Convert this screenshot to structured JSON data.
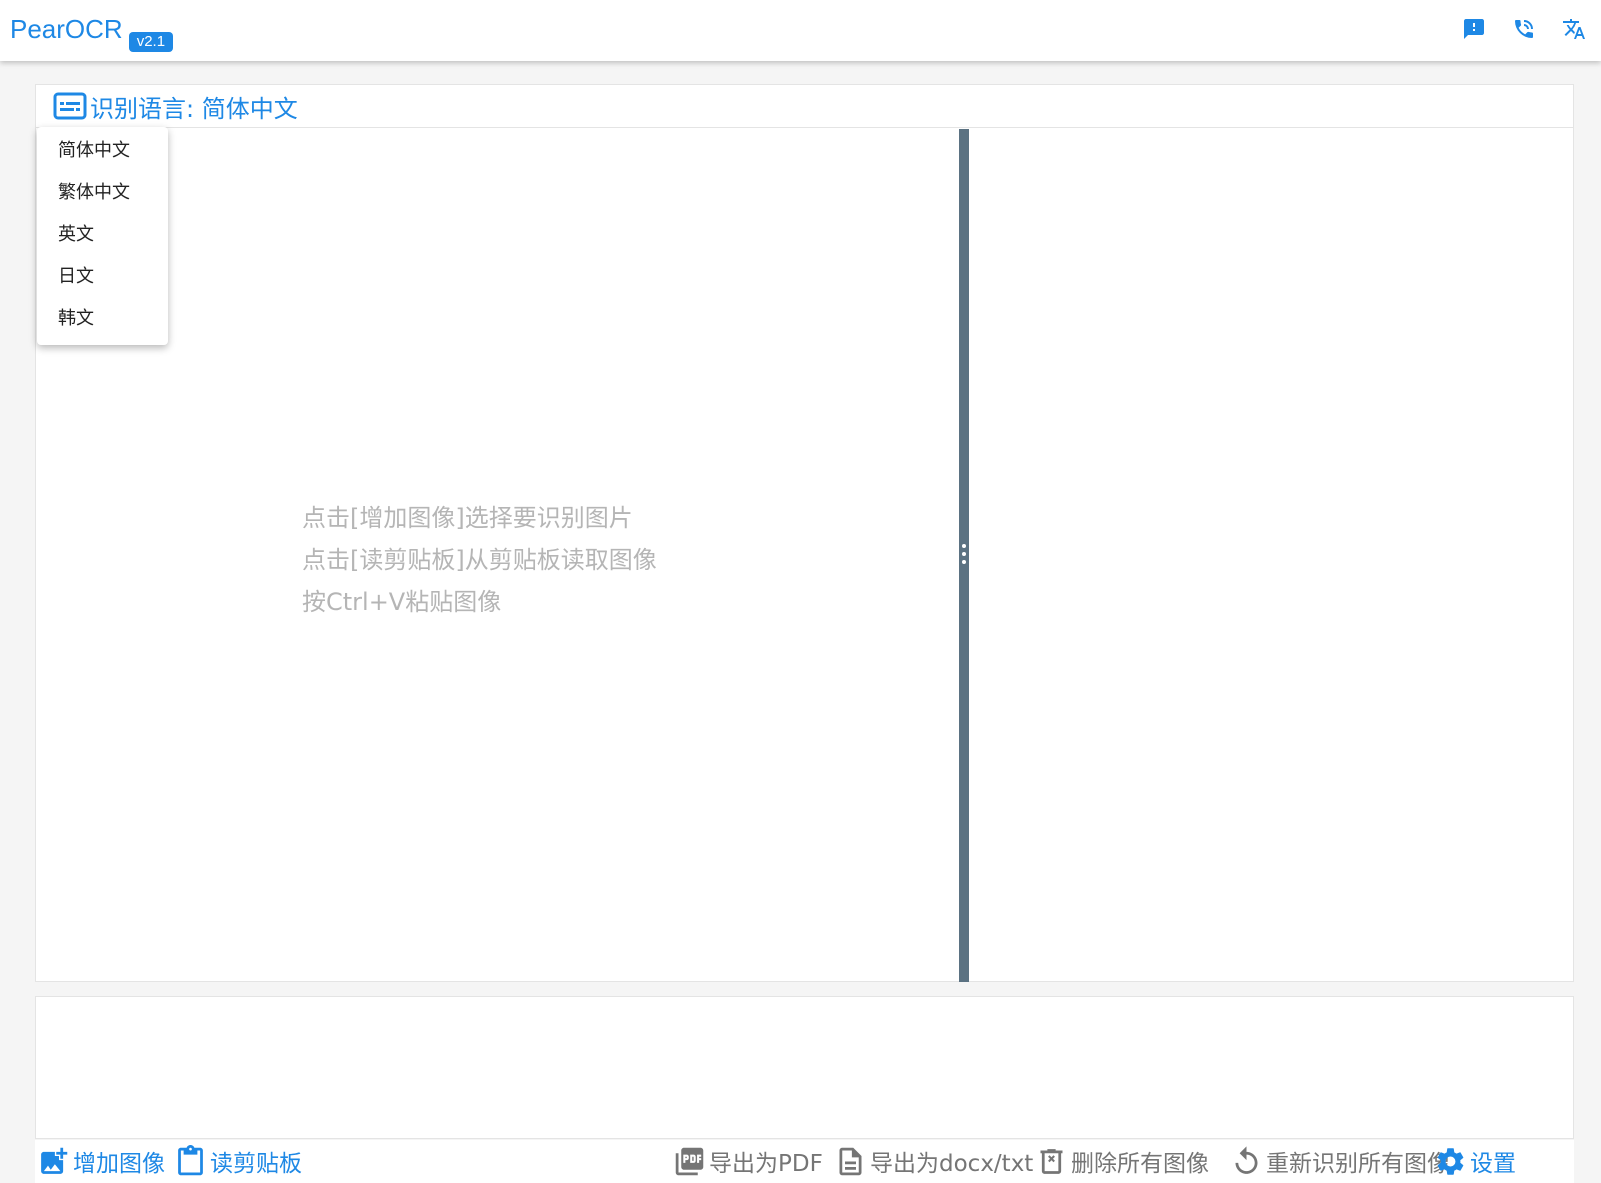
{
  "header": {
    "title": "PearOCR",
    "version": "v2.1",
    "actions": [
      {
        "name": "feedback-icon"
      },
      {
        "name": "contact-phone-icon"
      },
      {
        "name": "translate-icon"
      }
    ]
  },
  "colors": {
    "accent": "#1e88e5",
    "splitter": "#5b7282",
    "hint_text": "#b5b5b5",
    "toolbar_grey": "#757575"
  },
  "language_bar": {
    "label": "识别语言: 简体中文",
    "icon": "subtitles-icon"
  },
  "language_menu": {
    "items": [
      "简体中文",
      "繁体中文",
      "英文",
      "日文",
      "韩文"
    ]
  },
  "workspace": {
    "hints": [
      "点击[增加图像]选择要识别图片",
      "点击[读剪贴板]从剪贴板读取图像",
      "按Ctrl+V粘贴图像"
    ]
  },
  "toolbar": {
    "add_image": "增加图像",
    "read_clipboard": "读剪贴板",
    "export_pdf": "导出为PDF",
    "export_docx": "导出为docx/txt",
    "delete_all": "删除所有图像",
    "reocr_all": "重新识别所有图像",
    "settings": "设置"
  }
}
